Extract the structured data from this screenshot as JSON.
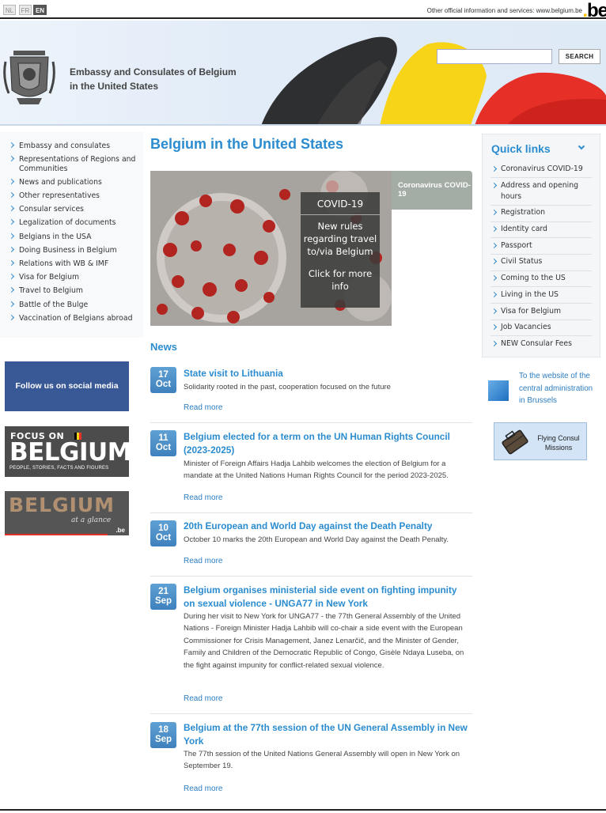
{
  "topbar": {
    "languages": [
      "NL",
      "FR",
      "EN"
    ],
    "active_language": "EN",
    "official_text": "Other official information and services:",
    "official_link": "www.belgium.be",
    "logo": ".be"
  },
  "header": {
    "search_placeholder": "",
    "search_button": "SEARCH",
    "site_title_line1": "Embassy and Consulates of Belgium",
    "site_title_line2": "in the United States"
  },
  "left_nav": {
    "items": [
      "Embassy and consulates",
      "Representations of Regions and Communities",
      "News and publications",
      "Other representatives",
      "Consular services",
      "Legalization of documents",
      "Belgians in the USA",
      "Doing Business in Belgium",
      "Relations with WB & IMF",
      "Visa for Belgium",
      "Travel to Belgium",
      "Battle of the Bulge",
      "Vaccination of Belgians abroad"
    ]
  },
  "banners": {
    "social": "Follow us on social media",
    "focus_line1": "FOCUS ON",
    "focus_line2": "BELGIUM",
    "focus_line3": "PEOPLE, STORIES, FACTS AND FIGURES",
    "glance_line1": "BELGIUM",
    "glance_line2": "at a glance",
    "glance_logo": ".be"
  },
  "main": {
    "title": "Belgium in the United States",
    "feature": {
      "box_title": "COVID-19",
      "box_message": "New rules regarding travel to/via Belgium",
      "box_cta": "Click for more info",
      "tab_label": "Coronavirus COVID-19"
    },
    "news_heading": "News",
    "news": [
      {
        "day": "17",
        "month": "Oct",
        "title": "State visit to Lithuania",
        "desc": "Solidarity rooted in the past, cooperation focused on the future",
        "more": "Read more"
      },
      {
        "day": "11",
        "month": "Oct",
        "title": "Belgium elected for a term on the UN Human Rights Council (2023-2025)",
        "desc": "Minister of Foreign Affairs Hadja Lahbib welcomes the election of Belgium for a mandate at the United Nations Human Rights Council for the period 2023-2025.",
        "more": "Read more"
      },
      {
        "day": "10",
        "month": "Oct",
        "title": "20th European and World Day against the Death Penalty",
        "desc": "October 10 marks the 20th European and World Day against the Death Penalty.",
        "more": "Read more"
      },
      {
        "day": "21",
        "month": "Sep",
        "title": "Belgium organises ministerial side event on fighting impunity on sexual violence - UNGA77 in New York",
        "desc": "During her visit to New York for UNGA77 - the 77th General Assembly of the United Nations - Foreign Minister Hadja Lahbib will co-chair a side event with the European Commissioner for Crisis Management, Janez Lenarčič, and the Minister of Gender, Family and Children of the Democratic Republic of Congo, Gisèle Ndaya Luseba, on the fight against impunity for conflict-related sexual violence.",
        "more": "Read more"
      },
      {
        "day": "18",
        "month": "Sep",
        "title": "Belgium at the 77th session of the UN General Assembly in New York",
        "desc": "The 77th session of the United Nations General Assembly will open in New York on September 19.",
        "more": "Read more"
      }
    ]
  },
  "quick_links": {
    "title": "Quick links",
    "items": [
      "Coronavirus COVID-19",
      "Address and opening hours",
      "Registration",
      "Identity card",
      "Passport",
      "Civil Status",
      "Coming to the US",
      "Living in the US",
      "Visa for Belgium",
      "Job Vacancies",
      "NEW Consular Fees"
    ]
  },
  "right_links": {
    "central": "To the website of the central administration in Brussels",
    "flying": "Flying Consul Missions"
  },
  "colors": {
    "accent": "#2b8ccf",
    "social": "#395896"
  }
}
